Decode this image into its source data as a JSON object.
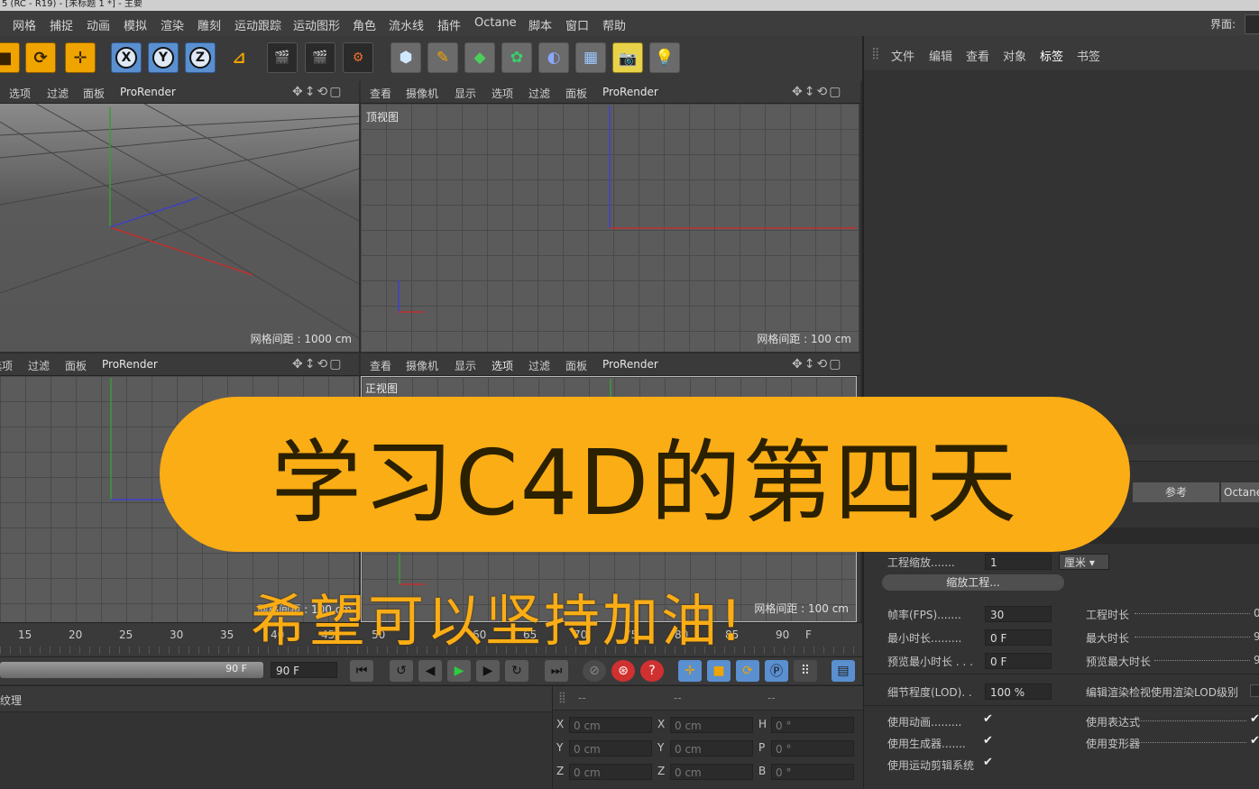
{
  "window": {
    "title": "5 (RC - R19) - [未标题 1 *] - 主要"
  },
  "menu": {
    "items": [
      "网格",
      "捕捉",
      "动画",
      "模拟",
      "渲染",
      "雕刻",
      "运动跟踪",
      "运动图形",
      "角色",
      "流水线",
      "插件",
      "Octane",
      "脚本",
      "窗口",
      "帮助"
    ],
    "right_label": "界面:"
  },
  "toolbar": {
    "axis_labels": [
      "X",
      "Y",
      "Z"
    ]
  },
  "viewports": {
    "tl": {
      "menu": [
        "选项",
        "过滤",
        "面板",
        "ProRender"
      ],
      "grid_text": "网格间距 : 1000 cm"
    },
    "tr": {
      "menu": [
        "查看",
        "摄像机",
        "显示",
        "选项",
        "过滤",
        "面板",
        "ProRender"
      ],
      "label": "顶视图",
      "grid_text": "网格间距 : 100 cm"
    },
    "bl": {
      "menu": [
        "选项",
        "过滤",
        "面板",
        "ProRender"
      ],
      "grid_text": "网格间距 : 100 cm"
    },
    "br": {
      "menu": [
        "查看",
        "摄像机",
        "显示",
        "选项",
        "过滤",
        "面板",
        "ProRender"
      ],
      "label": "正视图",
      "grid_text": "网格间距 : 100 cm"
    }
  },
  "object_panel": {
    "tabs": [
      "文件",
      "编辑",
      "查看",
      "对象",
      "标签",
      "书签"
    ]
  },
  "attributes": {
    "tabs": [
      "参考",
      "Octane"
    ],
    "project_scale_label": "工程缩放.......",
    "project_scale_value": "1",
    "project_scale_unit": "厘米",
    "scale_button": "缩放工程...",
    "fps_label": "帧率(FPS).......",
    "fps_value": "30",
    "min_time_label": "最小时长.........",
    "min_time_value": "0 F",
    "preview_min_label": "预览最小时长 . . .",
    "preview_min_value": "0 F",
    "project_time_label": "工程时长",
    "max_time_label": "最大时长",
    "preview_max_label": "预览最大时长",
    "right_clip_1": "0",
    "right_clip_2": "9",
    "right_clip_3": "9",
    "lod_label": "细节程度(LOD). .",
    "lod_value": "100 %",
    "lod_right_label": "编辑渲染检视使用渲染LOD级别",
    "use_anim_label": "使用动画.........",
    "use_gen_label": "使用生成器.......",
    "use_mograph_label": "使用运动剪辑系统",
    "use_expr_label": "使用表达式",
    "use_deform_label": "使用变形器",
    "check": "✔"
  },
  "timeline": {
    "ticks": [
      "15",
      "20",
      "25",
      "30",
      "35",
      "40",
      "45",
      "50",
      "60",
      "65",
      "70",
      "75",
      "80",
      "85",
      "90"
    ],
    "end_frame": "90 F",
    "end_frame_field": "90 F",
    "end_frame_suffix": "F"
  },
  "material_panel": {
    "label": "纹理"
  },
  "coordinates": {
    "header": [
      "--",
      "--",
      "--"
    ],
    "rows": [
      {
        "a": "X",
        "av": "0 cm",
        "b": "X",
        "bv": "0 cm",
        "c": "H",
        "cv": "0 °"
      },
      {
        "a": "Y",
        "av": "0 cm",
        "b": "Y",
        "bv": "0 cm",
        "c": "P",
        "cv": "0 °"
      },
      {
        "a": "Z",
        "av": "0 cm",
        "b": "Z",
        "bv": "0 cm",
        "c": "B",
        "cv": "0 °"
      }
    ]
  },
  "overlay": {
    "title": "学习C4D的第四天",
    "subtitle": "希望可以坚持加油!"
  },
  "colors": {
    "accent": "#fbad15",
    "toolbar_orange": "#f0a400",
    "axis_blue": "#5a8fd0"
  }
}
